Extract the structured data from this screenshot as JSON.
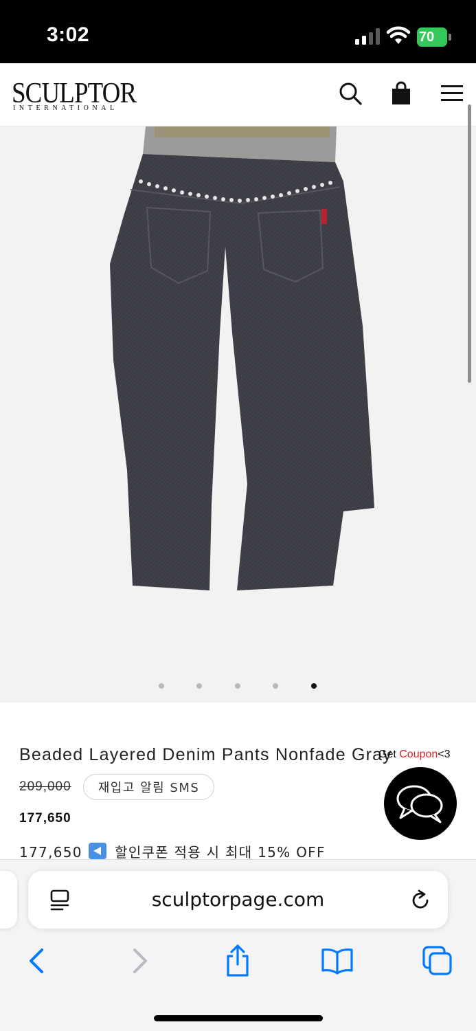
{
  "status_bar": {
    "time": "3:02",
    "battery": "70",
    "icons": [
      "signal-icon",
      "wifi-icon",
      "battery-charging-icon"
    ]
  },
  "header": {
    "logo_main": "SCULPTOR",
    "logo_sub": "INTERNATIONAL",
    "icons": [
      "search-icon",
      "shopping-bag-icon",
      "menu-icon"
    ]
  },
  "gallery": {
    "image_subject": "jeans-product-photo",
    "slide_count": 5,
    "active_slide": 5
  },
  "product": {
    "name": "Beaded Layered Denim Pants Nonfade Gray",
    "original_price": "209,000",
    "restock_button": "재입고 알림 SMS",
    "sale_price": "177,650",
    "coupon_price": "177,650",
    "coupon_text": "할인쿠폰 적용 시 최대 15% OFF"
  },
  "floating": {
    "coupon_prefix": "Get ",
    "coupon_word": "Coupon",
    "coupon_suffix": "<3",
    "chat_icon": "chat-bubbles-icon"
  },
  "browser": {
    "url": "sculptorpage.com",
    "icons": [
      "page-menu-icon",
      "reload-icon",
      "back-icon",
      "forward-icon",
      "share-icon",
      "bookmarks-icon",
      "tabs-icon"
    ]
  },
  "colors": {
    "accent_blue": "#007aff",
    "coupon_red": "#e02020",
    "battery_green": "#34c759"
  }
}
